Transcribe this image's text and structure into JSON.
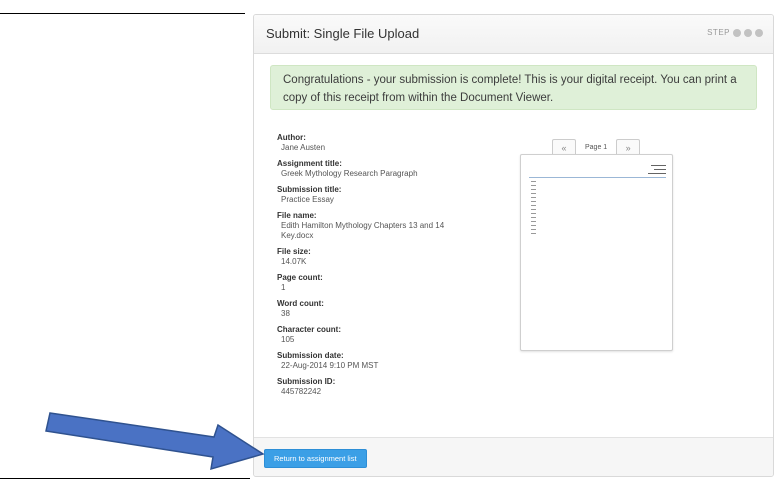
{
  "panel": {
    "title": "Submit: Single File Upload",
    "step_label": "STEP"
  },
  "alert": {
    "message": "Congratulations - your submission is complete! This is your digital receipt. You can print a copy of this receipt from within the Document Viewer."
  },
  "receipt": {
    "author": {
      "label": "Author:",
      "value": "Jane Austen"
    },
    "assignment_title": {
      "label": "Assignment title:",
      "value": "Greek Mythology Research Paragraph"
    },
    "submission_title": {
      "label": "Submission title:",
      "value": "Practice Essay"
    },
    "file_name": {
      "label": "File name:",
      "value": "Edith Hamilton Mythology Chapters 13 and 14 Key.docx"
    },
    "file_size": {
      "label": "File size:",
      "value": "14.07K"
    },
    "page_count": {
      "label": "Page count:",
      "value": "1"
    },
    "word_count": {
      "label": "Word count:",
      "value": "38"
    },
    "character_count": {
      "label": "Character count:",
      "value": "105"
    },
    "submission_date": {
      "label": "Submission date:",
      "value": "22-Aug-2014 9:10 PM MST"
    },
    "submission_id": {
      "label": "Submission ID:",
      "value": "445782242"
    }
  },
  "viewer": {
    "prev_symbol": "«",
    "next_symbol": "»",
    "page_label": "Page 1"
  },
  "footer": {
    "return_button_label": "Return to assignment list"
  },
  "colors": {
    "alert_bg": "#dff0d8",
    "button_blue": "#3b9fe6",
    "arrow_blue": "#4a72c4"
  }
}
